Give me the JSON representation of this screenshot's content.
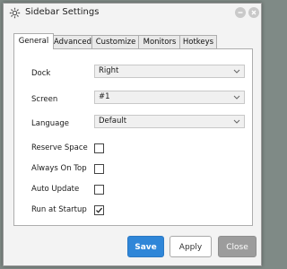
{
  "window": {
    "title": "Sidebar Settings"
  },
  "icons": {
    "title": "gear-icon",
    "minimize": "minimize-icon",
    "close": "close-icon"
  },
  "tabs": [
    {
      "label": "General",
      "active": true
    },
    {
      "label": "Advanced",
      "active": false
    },
    {
      "label": "Customize",
      "active": false
    },
    {
      "label": "Monitors",
      "active": false
    },
    {
      "label": "Hotkeys",
      "active": false
    }
  ],
  "settings": {
    "dock": {
      "label": "Dock",
      "value": "Right"
    },
    "screen": {
      "label": "Screen",
      "value": "#1"
    },
    "language": {
      "label": "Language",
      "value": "Default"
    },
    "reserve_space": {
      "label": "Reserve Space",
      "checked": false
    },
    "always_on_top": {
      "label": "Always On Top",
      "checked": false
    },
    "auto_update": {
      "label": "Auto Update",
      "checked": false
    },
    "run_at_startup": {
      "label": "Run at Startup",
      "checked": true
    }
  },
  "buttons": {
    "save": "Save",
    "apply": "Apply",
    "close": "Close"
  },
  "colors": {
    "accent": "#2f86d8",
    "disabled": "#9c9c9c"
  }
}
